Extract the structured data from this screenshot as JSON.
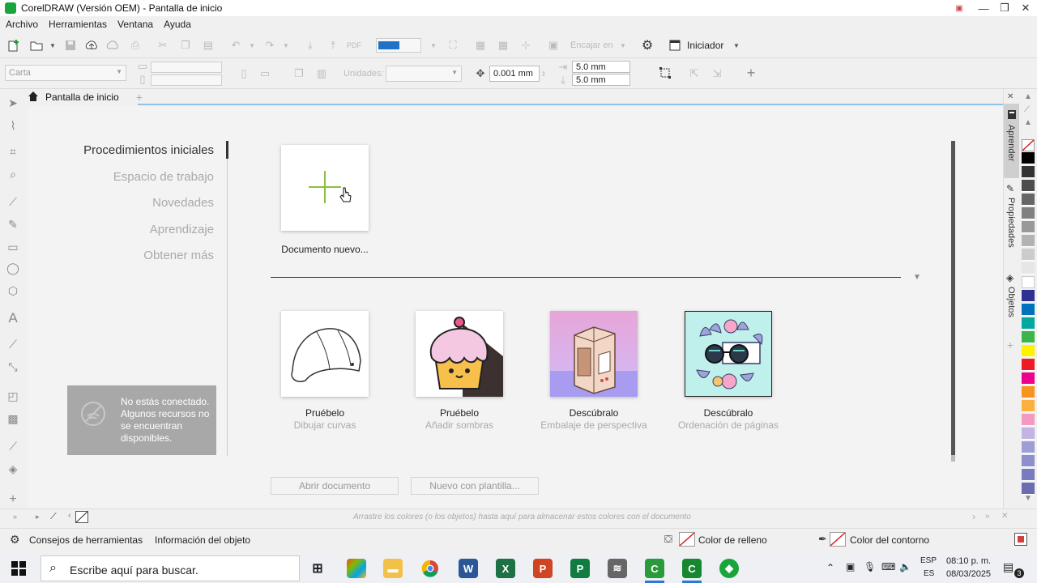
{
  "window": {
    "title": "CorelDRAW (Versión OEM) - Pantalla de inicio",
    "controls": {
      "pin": "▣",
      "minimize": "—",
      "maximize": "❐",
      "close": "✕"
    }
  },
  "menu": {
    "items": [
      {
        "label": "Archivo"
      },
      {
        "label": "Herramientas"
      },
      {
        "label": "Ventana"
      },
      {
        "label": "Ayuda"
      }
    ]
  },
  "toolbar": {
    "snap_to": "Encajar en",
    "workspace": "Iniciador",
    "page_preset": "Carta",
    "units_label": "Unidades:",
    "nudge": "0.001 mm",
    "dup_x": "5.0 mm",
    "dup_y": "5.0 mm",
    "add_icon": "+"
  },
  "tabs": {
    "home": "Pantalla de inicio",
    "new_tab": "+"
  },
  "nav": {
    "items": [
      {
        "label": "Procedimientos iniciales",
        "active": true
      },
      {
        "label": "Espacio de trabajo",
        "active": false
      },
      {
        "label": "Novedades",
        "active": false
      },
      {
        "label": "Aprendizaje",
        "active": false
      },
      {
        "label": "Obtener más",
        "active": false
      }
    ]
  },
  "offline": {
    "message": "No estás conectado. Algunos recursos no se encuentran disponibles."
  },
  "new_document": {
    "label": "Documento nuevo..."
  },
  "cards": [
    {
      "title": "Pruébelo",
      "subtitle": "Dibujar curvas"
    },
    {
      "title": "Pruébelo",
      "subtitle": "Añadir sombras"
    },
    {
      "title": "Descúbralo",
      "subtitle": "Embalaje de perspectiva"
    },
    {
      "title": "Descúbralo",
      "subtitle": "Ordenación de páginas"
    }
  ],
  "buttons": {
    "open_document": "Abrir documento",
    "new_from_template": "Nuevo con plantilla..."
  },
  "dock": {
    "learn": "Aprender",
    "properties": "Propiedades",
    "objects": "Objetos"
  },
  "palette": {
    "colors": [
      "#000000",
      "#333333",
      "#4d4d4d",
      "#666666",
      "#808080",
      "#999999",
      "#b3b3b3",
      "#cccccc",
      "#e6e6e6",
      "#ffffff",
      "#2e3192",
      "#0071bc",
      "#00a99d",
      "#39b54a",
      "#fff200",
      "#ed1c24",
      "#ec008c",
      "#f7941d",
      "#fbb040",
      "#f49ac1",
      "#c2b5e3",
      "#9e9ed6",
      "#8f8fd0",
      "#7a7ac0",
      "#6c6cb0"
    ]
  },
  "doc_palette": {
    "hint": "Arrastre los colores (o los objetos) hasta aquí para almacenar estos colores con el documento"
  },
  "status": {
    "hints": "Consejos de herramientas",
    "object_info": "Información del objeto",
    "fill_color": "Color de relleno",
    "outline_color": "Color del contorno"
  },
  "taskbar": {
    "search_placeholder": "Escribe aquí para buscar.",
    "lang_top": "ESP",
    "lang_bottom": "ES",
    "time": "08:10 p. m.",
    "date": "08/03/2025",
    "notifications": "3"
  }
}
